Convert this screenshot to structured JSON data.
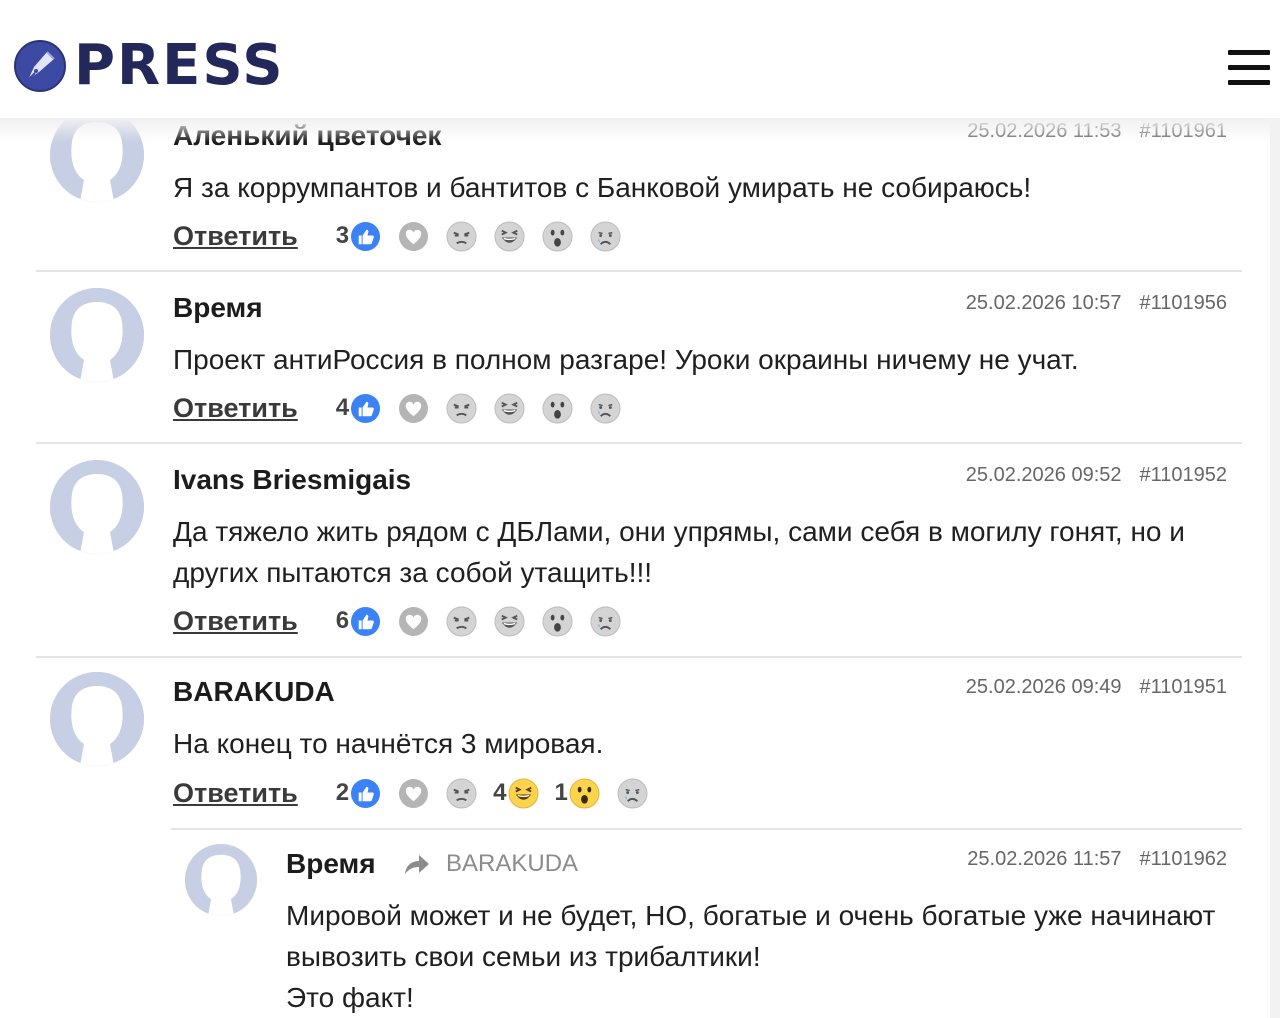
{
  "site": {
    "logo_text": "PRESS",
    "menu_icon": "hamburger-icon"
  },
  "colors": {
    "brand": "#23285a",
    "like": "#3b82f6",
    "avatar": "#c7cfe4",
    "divider": "#e4e4e4"
  },
  "comments": [
    {
      "author": "Аленький цветочек",
      "date": "25.02.2026 11:53",
      "id": "#1101961",
      "text": "Я за коррумпантов и бантитов с Банковой умирать не собираюсь!",
      "reply_label": "Ответить",
      "reactions": {
        "like": "3",
        "love": "",
        "angry": "",
        "laugh": "",
        "wow": "",
        "sad": ""
      }
    },
    {
      "author": "Время",
      "date": "25.02.2026 10:57",
      "id": "#1101956",
      "text": "Проект антиРоссия в полном разгаре! Уроки окраины ничему не учат.",
      "reply_label": "Ответить",
      "reactions": {
        "like": "4",
        "love": "",
        "angry": "",
        "laugh": "",
        "wow": "",
        "sad": ""
      }
    },
    {
      "author": "Ivans Briesmigais",
      "date": "25.02.2026 09:52",
      "id": "#1101952",
      "text": "Да тяжело жить рядом с ДБЛами, они упрямы, сами себя в могилу гонят, но и других пытаются за собой утащить!!!",
      "reply_label": "Ответить",
      "reactions": {
        "like": "6",
        "love": "",
        "angry": "",
        "laugh": "",
        "wow": "",
        "sad": ""
      }
    },
    {
      "author": "BARAKUDA",
      "date": "25.02.2026 09:49",
      "id": "#1101951",
      "text": "На конец то начнётся 3 мировая.",
      "reply_label": "Ответить",
      "reactions": {
        "like": "2",
        "love": "",
        "angry": "",
        "laugh": "4",
        "wow": "1",
        "sad": ""
      }
    },
    {
      "author": "Время",
      "reply_to": "BARAKUDA",
      "date": "25.02.2026 11:57",
      "id": "#1101962",
      "text": "Мировой может и не будет, НО, богатые и очень богатые уже начинают вывозить свои семьи из трибалтики!\nЭто факт!"
    }
  ]
}
